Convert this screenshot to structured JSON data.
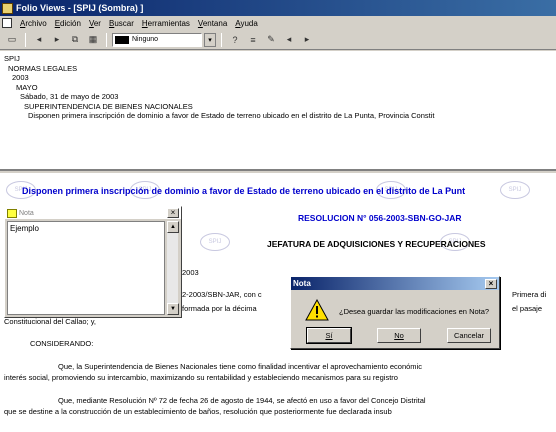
{
  "window": {
    "title": "Folio Views - [SPIJ (Sombra) ]"
  },
  "menubar": {
    "items": [
      "Archivo",
      "Edición",
      "Ver",
      "Buscar",
      "Herramientas",
      "Ventana",
      "Ayuda"
    ]
  },
  "toolbar": {
    "highlighter_value": "Ninguno",
    "icons": [
      "print-icon",
      "back-icon",
      "forward-icon",
      "copy-icon",
      "layout-icon",
      "highlighter-icon",
      "dropdown-icon",
      "query-icon",
      "list-icon",
      "pen-icon",
      "prev-hit-icon",
      "next-hit-icon"
    ]
  },
  "tree": {
    "lines": [
      "SPIJ",
      "NORMAS LEGALES",
      "2003",
      "MAYO",
      "Sábado, 31 de mayo de 2003",
      "SUPERINTENDENCIA DE BIENES NACIONALES",
      "Disponen primera inscripción de dominio a favor de Estado de terreno ubicado en el distrito de La Punta, Provincia Constit"
    ]
  },
  "document": {
    "headline": "Disponen primera inscripción de dominio a favor de Estado de terreno ubicado en el distrito de La Punt",
    "resolution": "RESOLUCION N° 056-2003-SBN-GO-JAR",
    "office": "JEFATURA DE ADQUISICIONES Y RECUPERACIONES",
    "date_fragment": "2003",
    "line_ref": "2-2003/SBN-JAR, con c",
    "line_ref_right": "Primera di",
    "line_formed": "formada por la décima",
    "line_formed_right": "el pasaje",
    "line_callao": "Constitucional del Callao; y,",
    "considerando": "CONSIDERANDO:",
    "para1_a": "Que, la Superintendencia de Bienes Nacionales tiene como finalidad incentivar el aprovechamiento económic",
    "para1_b": "interés social, promoviendo su intercambio, maximizando su rentabilidad y estableciendo mecanismos para su registro",
    "para2_a": "Que, mediante Resolución Nº 72 de fecha 26 de agosto de 1944, se afectó en uso a favor del Concejo Distrital",
    "para2_b": "que se destine a la construcción de un establecimiento de baños, resolución que posteriormente fue declarada insub",
    "seal_text": "SPIJ"
  },
  "nota_window": {
    "title": "Nota",
    "content": "Ejemplo"
  },
  "dialog": {
    "title": "Nota",
    "message": "¿Desea guardar las modificaciones en Nota?",
    "yes": "Sí",
    "no": "No",
    "cancel": "Cancelar"
  }
}
